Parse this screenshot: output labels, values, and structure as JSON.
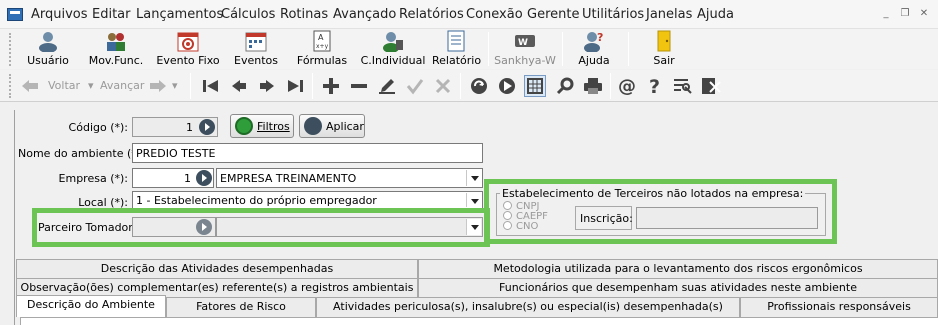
{
  "menu": [
    "Arquivos",
    "Editar",
    "Lançamentos",
    "Cálculos",
    "Rotinas",
    "Avançado",
    "Relatórios",
    "Conexão",
    "Gerente",
    "Utilitários",
    "Janelas",
    "Ajuda"
  ],
  "window_controls": [
    "_",
    "❐",
    "✕"
  ],
  "toolbar": {
    "usuario": "Usuário",
    "mov_func": "Mov.Func.",
    "evento_fixo": "Evento Fixo",
    "eventos": "Eventos",
    "formulas": "Fórmulas",
    "c_individual": "C.Individual",
    "relatorio": "Relatório",
    "sankhya": "Sankhya-W",
    "ajuda": "Ajuda",
    "sair": "Sair"
  },
  "nav": {
    "voltar": "Voltar",
    "avancar": "Avançar"
  },
  "form": {
    "codigo_label": "Código (*):",
    "codigo_value": "1",
    "filtros_label": "Filtros",
    "aplicar_label": "Aplicar",
    "nome_label": "Nome do ambiente (*):",
    "nome_value": "PREDIO TESTE",
    "empresa_label": "Empresa (*):",
    "empresa_code": "1",
    "empresa_name": "EMPRESA TREINAMENTO",
    "local_label": "Local (*):",
    "local_value": "1 - Estabelecimento do próprio empregador",
    "parceiro_label": "Parceiro Tomador:",
    "parceiro_code": "",
    "parceiro_name": ""
  },
  "terceiros": {
    "title": "Estabelecimento de Terceiros não lotados na empresa:",
    "options": [
      "CNPJ",
      "CAEPF",
      "CNO"
    ],
    "inscricao_label": "Inscrição:",
    "inscricao_value": ""
  },
  "tabs": {
    "row1": [
      "Descrição das Atividades desempenhadas",
      "Metodologia utilizada para o levantamento dos riscos ergonômicos"
    ],
    "row2": [
      "Observação(ões) complementar(es) referente(s) a registros ambientais",
      "Funcionários que desempenham suas atividades neste ambiente"
    ],
    "row3": [
      "Descrição do Ambiente",
      "Fatores de Risco",
      "Atividades periculosa(s), insalubre(s) ou especial(is) desempenhada(s)",
      "Profissionais responsáveis"
    ]
  },
  "colors": {
    "highlight_green": "#6cc454",
    "lookup_dark": "#3d4f5e"
  }
}
